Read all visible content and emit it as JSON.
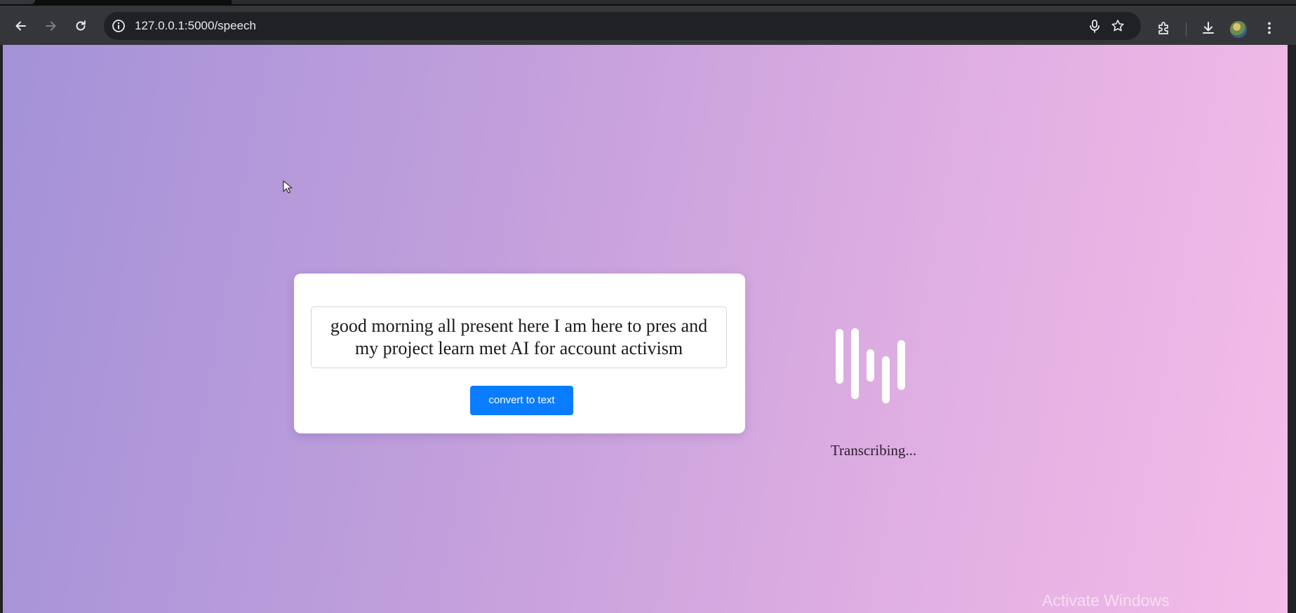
{
  "browser": {
    "url": "127.0.0.1:5000/speech",
    "nav": {
      "back": "back-icon",
      "forward": "forward-icon",
      "reload": "reload-icon"
    },
    "omnibox_icons": [
      "info-icon",
      "microphone-icon",
      "bookmark-star-icon"
    ],
    "toolbar_icons": [
      "extensions-icon",
      "downloads-icon",
      "profile-avatar",
      "more-menu-icon"
    ]
  },
  "page": {
    "transcript_text": "good morning all present here I am here to pres and my project learn met AI for account activism",
    "convert_button_label": "convert to text",
    "status_text": "Transcribing...",
    "accent_color": "#0a7cff",
    "background_gradient": [
      "#a392d8",
      "#f4bce8"
    ]
  },
  "os_overlay": {
    "watermark": "Activate Windows"
  }
}
